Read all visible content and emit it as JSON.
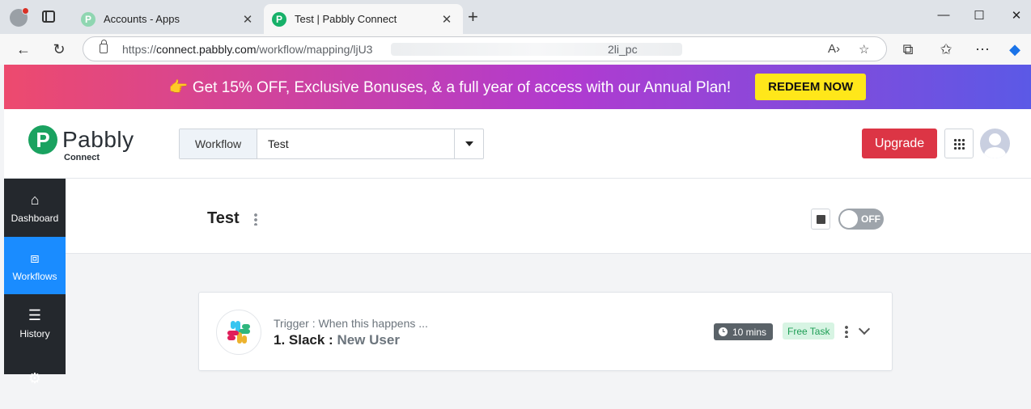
{
  "browser": {
    "tabs": [
      {
        "title": "Accounts - Apps",
        "active": false
      },
      {
        "title": "Test | Pabbly Connect",
        "active": true
      }
    ],
    "new_tab_icon": "plus-icon",
    "address": {
      "scheme": "https://",
      "domain": "connect.pabbly.com",
      "path": "/workflow/mapping/ljU3",
      "tail": "2li_pc"
    }
  },
  "banner": {
    "emoji": "👉",
    "text": "Get 15% OFF, Exclusive Bonuses, & a full year of access with our Annual Plan!",
    "button": "REDEEM NOW"
  },
  "header": {
    "logo_mark": "P",
    "logo_text": "Pabbly",
    "logo_sub": "Connect",
    "workflow_label": "Workflow",
    "workflow_value": "Test",
    "upgrade": "Upgrade"
  },
  "sidebar": {
    "items": [
      {
        "label": "Dashboard",
        "icon": "home-icon"
      },
      {
        "label": "Workflows",
        "icon": "workflow-icon"
      },
      {
        "label": "History",
        "icon": "history-icon"
      }
    ]
  },
  "workflow": {
    "title": "Test",
    "toggle_label": "OFF"
  },
  "trigger": {
    "caption": "Trigger : When this happens ...",
    "title": "1. Slack :",
    "event": "New User",
    "time": "10 mins",
    "task": "Free Task"
  },
  "colors": {
    "upgrade": "#dc3545",
    "active_nav": "#1a8cff",
    "redeem": "#ffe71a",
    "brand": "#1aa260"
  }
}
